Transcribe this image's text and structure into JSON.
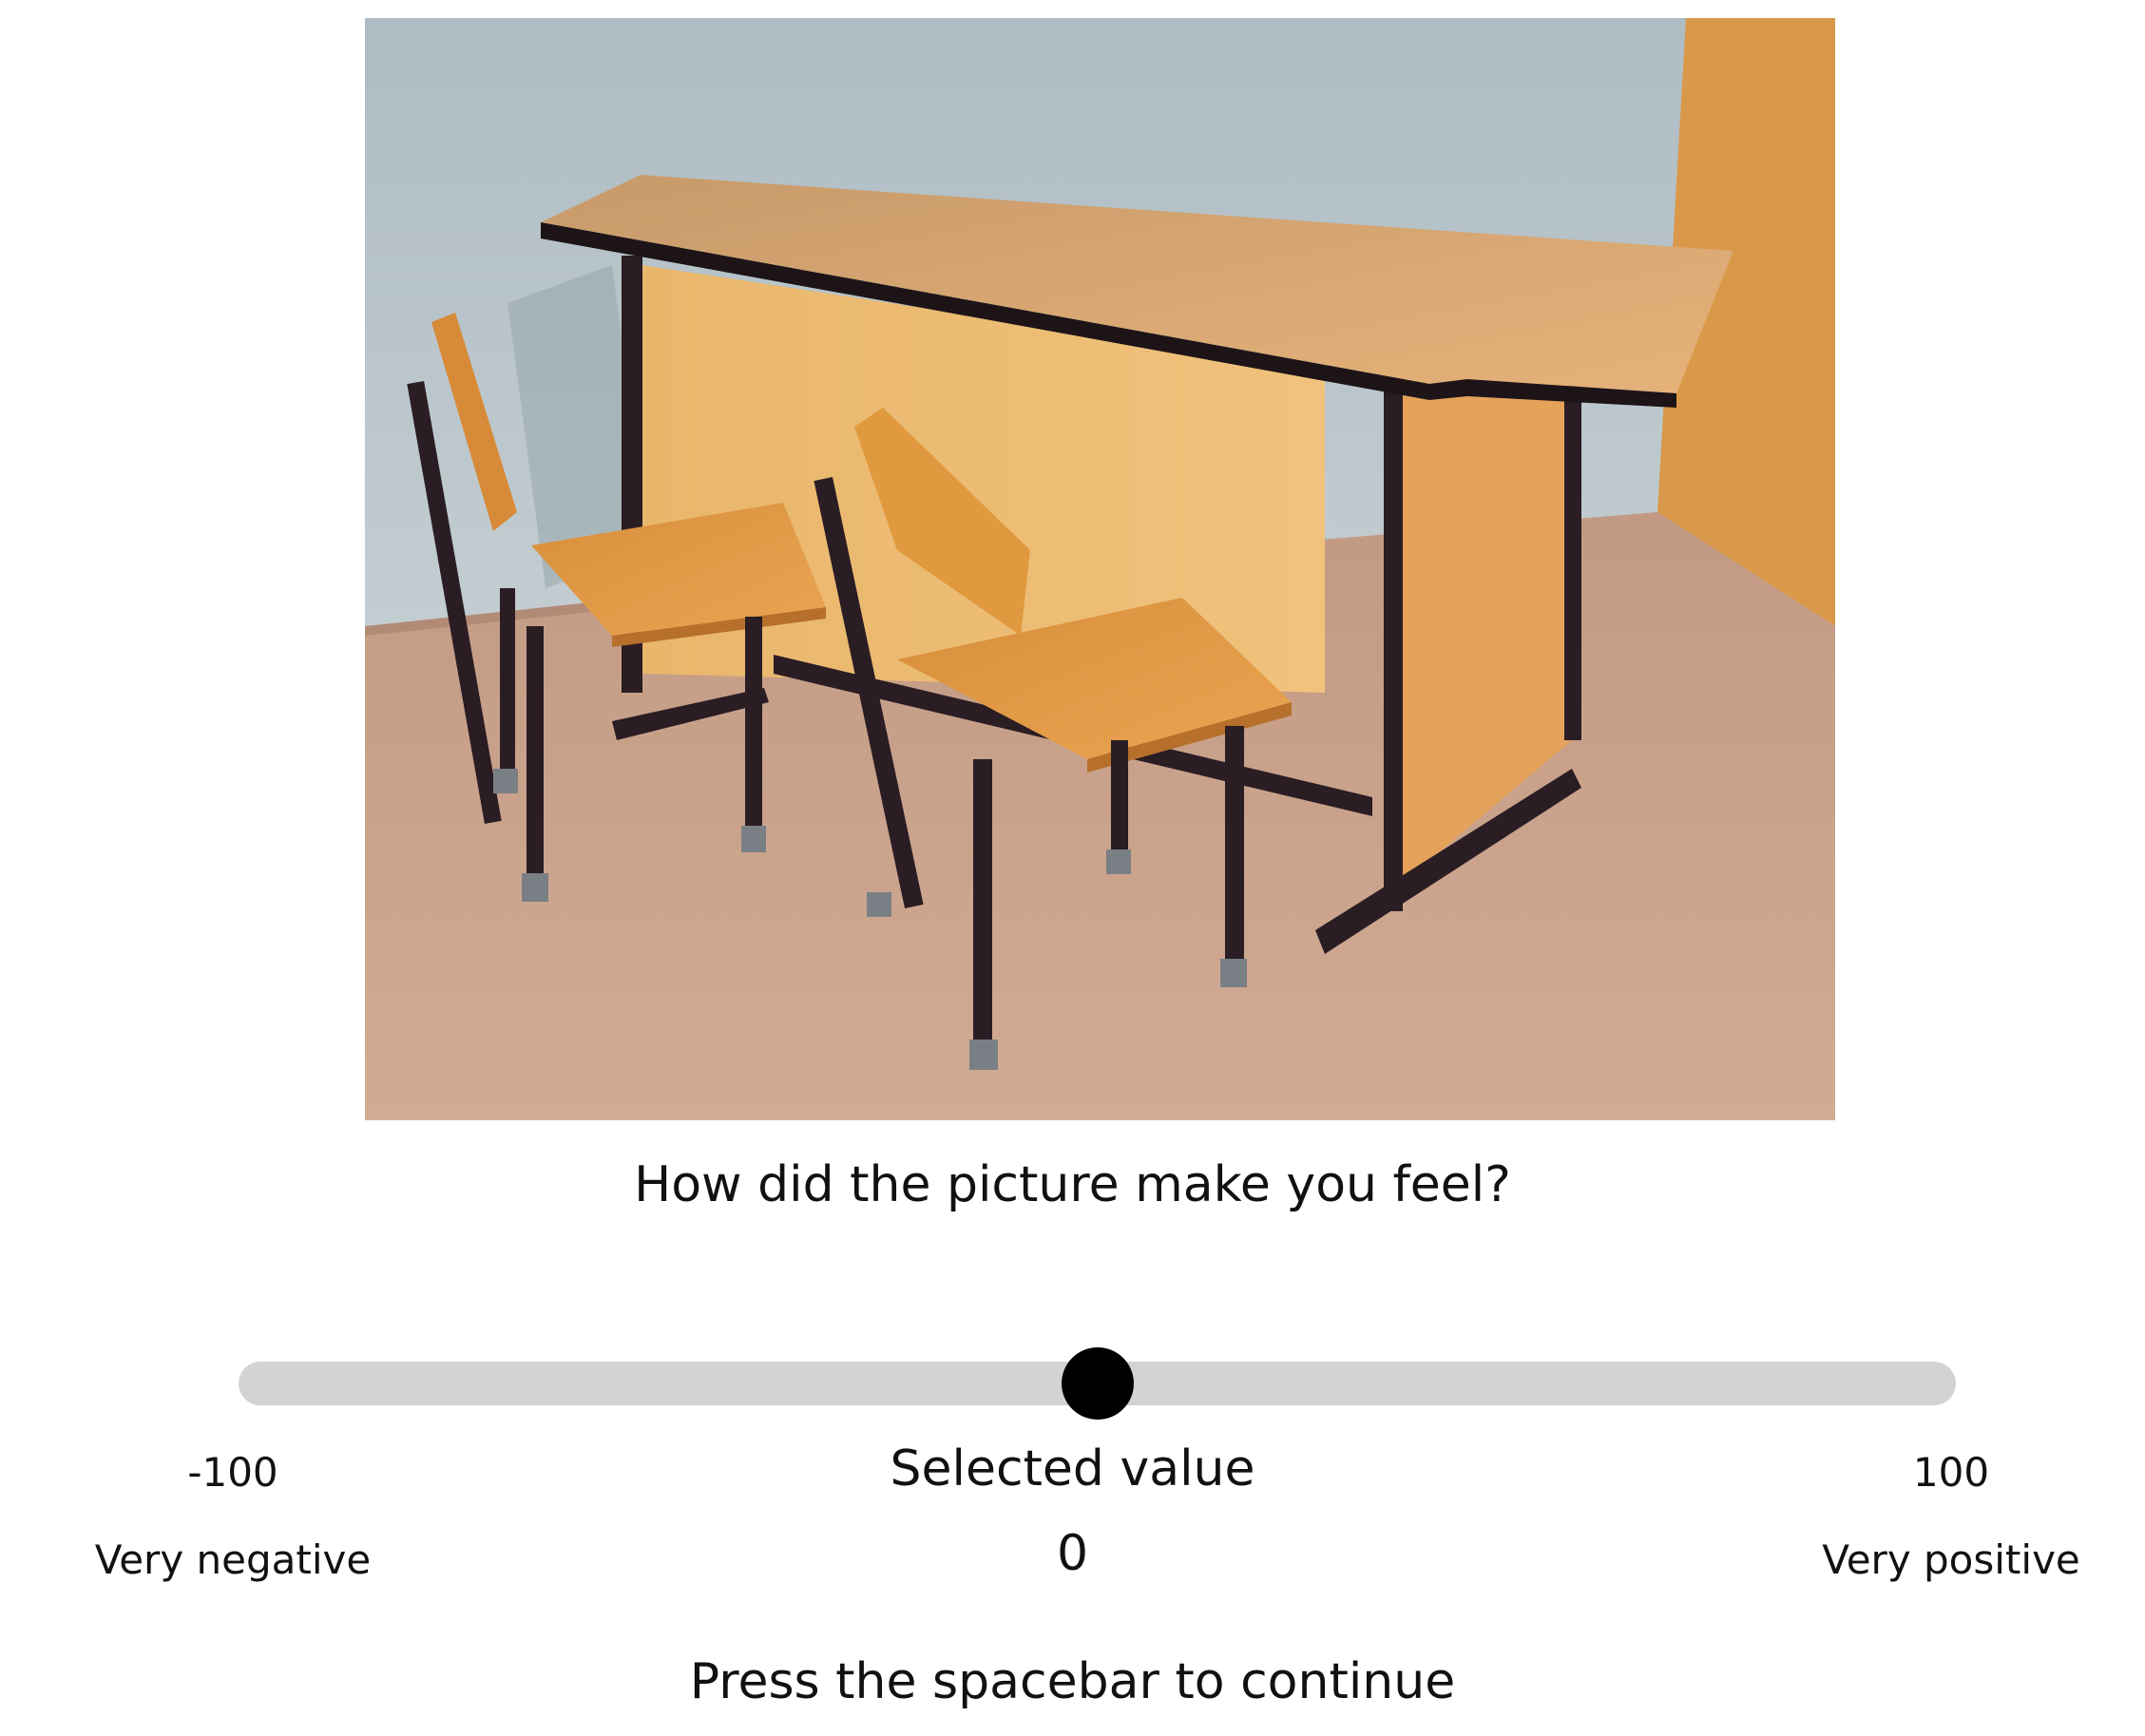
{
  "stimulus": {
    "subject": "wooden desk with two chairs",
    "colors": {
      "wall": "#b9c6cc",
      "wall_right": "#d99a4a",
      "floor": "#c9a48c",
      "wood": "#e0a04a",
      "frame": "#2a1d24"
    }
  },
  "question": "How did the picture make you feel?",
  "slider": {
    "min": -100,
    "max": 100,
    "value": 0,
    "min_value_text": "-100",
    "max_value_text": "100",
    "min_label": "Very negative",
    "max_label": "Very positive",
    "track_color": "#d3d3d3",
    "thumb_color": "#000000"
  },
  "selected": {
    "caption": "Selected value",
    "value_text": "0"
  },
  "prompt": "Press the spacebar to continue"
}
